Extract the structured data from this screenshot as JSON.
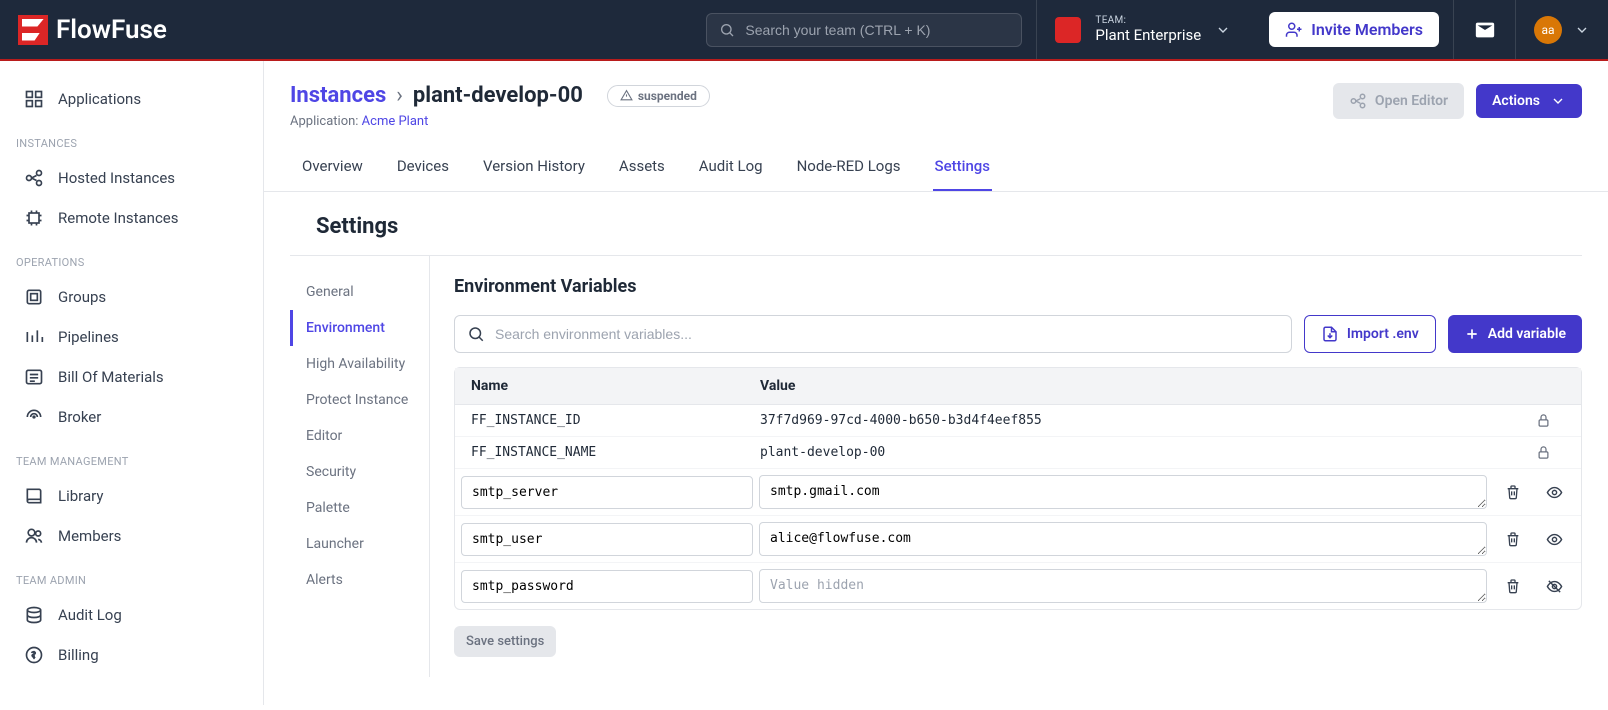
{
  "header": {
    "brand": "FlowFuse",
    "search_placeholder": "Search your team (CTRL + K)",
    "team_label": "TEAM:",
    "team_name": "Plant Enterprise",
    "invite_label": "Invite Members",
    "user_initials": "aa"
  },
  "sidebar": {
    "applications": "Applications",
    "sec_instances": "INSTANCES",
    "hosted": "Hosted Instances",
    "remote": "Remote Instances",
    "sec_operations": "OPERATIONS",
    "groups": "Groups",
    "pipelines": "Pipelines",
    "bom": "Bill Of Materials",
    "broker": "Broker",
    "sec_team_mgmt": "TEAM MANAGEMENT",
    "library": "Library",
    "members": "Members",
    "sec_team_admin": "TEAM ADMIN",
    "audit": "Audit Log",
    "billing": "Billing"
  },
  "breadcrumb": {
    "root": "Instances",
    "current": "plant-develop-00",
    "status": "suspended",
    "app_label": "Application: ",
    "app_name": "Acme Plant",
    "open_editor": "Open Editor",
    "actions": "Actions"
  },
  "tabs": {
    "overview": "Overview",
    "devices": "Devices",
    "version": "Version History",
    "assets": "Assets",
    "audit": "Audit Log",
    "logs": "Node-RED Logs",
    "settings": "Settings"
  },
  "settings": {
    "title": "Settings",
    "nav": {
      "general": "General",
      "env": "Environment",
      "ha": "High Availability",
      "protect": "Protect Instance",
      "editor": "Editor",
      "security": "Security",
      "palette": "Palette",
      "launcher": "Launcher",
      "alerts": "Alerts"
    }
  },
  "panel": {
    "title": "Environment Variables",
    "search_placeholder": "Search environment variables...",
    "import_label": "Import .env",
    "add_label": "Add variable",
    "col_name": "Name",
    "col_value": "Value",
    "save_label": "Save settings",
    "locked": [
      {
        "name": "FF_INSTANCE_ID",
        "value": "37f7d969-97cd-4000-b650-b3d4f4eef855"
      },
      {
        "name": "FF_INSTANCE_NAME",
        "value": "plant-develop-00"
      }
    ],
    "editable": [
      {
        "name": "smtp_server",
        "value": "smtp.gmail.com",
        "hidden": false
      },
      {
        "name": "smtp_user",
        "value": "alice@flowfuse.com",
        "hidden": false
      },
      {
        "name": "smtp_password",
        "value": "",
        "placeholder": "Value hidden",
        "hidden": true
      }
    ]
  }
}
